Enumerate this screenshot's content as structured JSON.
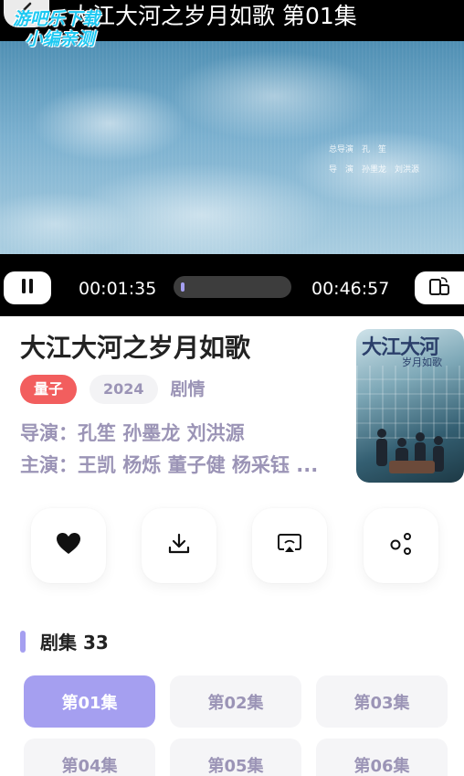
{
  "player": {
    "title": "大江大河之岁月如歌 第01集",
    "watermark_line1": "游吧乐下载",
    "watermark_line2": "小编亲测",
    "credits_line1": "总导演　孔　笙",
    "credits_line2": "导　演　孙墨龙　刘洪源",
    "current_time": "00:01:35",
    "total_time": "00:46:57",
    "progress": 0.034
  },
  "show": {
    "title": "大江大河之岁月如歌",
    "badge": "量子",
    "year": "2024",
    "genre": "剧情",
    "director": "导演：孔笙 孙墨龙 刘洪源",
    "cast": "主演：王凯 杨烁 董子健 杨采钰 ...",
    "poster_title": "大江大河",
    "poster_subtitle": "岁月如歌"
  },
  "actions": {
    "favorite_icon": "heart-icon",
    "download_icon": "download-icon",
    "cast_icon": "screen-cast-icon",
    "share_icon": "share-icon"
  },
  "episodes": {
    "heading": "剧集 33",
    "items": [
      "第01集",
      "第02集",
      "第03集",
      "第04集",
      "第05集",
      "第06集"
    ],
    "active": "第01集"
  },
  "colors": {
    "accent": "#a59ff0",
    "badge_red": "#f25e5e",
    "muted_text": "#9b94b6"
  }
}
